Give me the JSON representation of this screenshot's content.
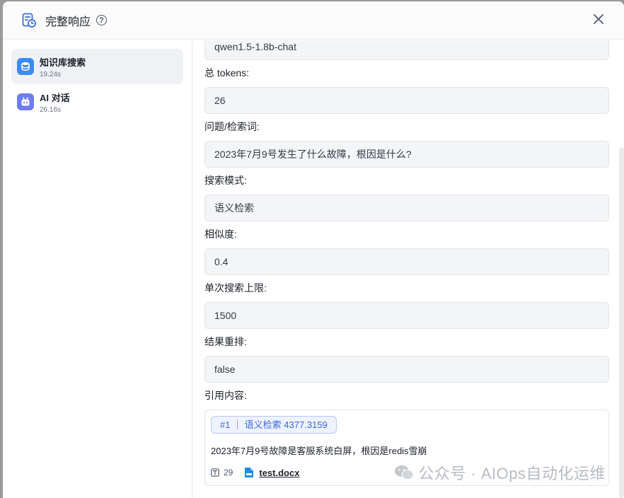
{
  "header": {
    "title": "完整响应",
    "help_symbol": "?"
  },
  "sidebar": {
    "items": [
      {
        "name": "知识库搜索",
        "time": "19.24s",
        "icon": "database-icon",
        "color": "#3b8cf5",
        "active": true
      },
      {
        "name": "AI 对话",
        "time": "26.16s",
        "icon": "robot-icon",
        "color": "#6f7cf6",
        "active": false
      }
    ]
  },
  "fields": {
    "model": {
      "value": "qwen1.5-1.8b-chat"
    },
    "tokens": {
      "label": "总 tokens:",
      "value": "26"
    },
    "question": {
      "label": "问题/检索词:",
      "value": "2023年7月9号发生了什么故障，根因是什么?"
    },
    "search_mode": {
      "label": "搜索模式:",
      "value": "语义检索"
    },
    "similarity": {
      "label": "相似度:",
      "value": "0.4"
    },
    "limit": {
      "label": "单次搜索上限:",
      "value": "1500"
    },
    "rerank": {
      "label": "结果重排:",
      "value": "false"
    },
    "quotes": {
      "label": "引用内容:",
      "tag": "#1 ｜ 语义检索 4377.3159",
      "text": "2023年7月9号故障是客服系统白屏，根因是redis雪崩",
      "count": "29",
      "file": "test.docx"
    }
  },
  "watermark": {
    "text": "公众号 · AIOps自动化运维"
  },
  "colors": {
    "accent": "#3d65d6",
    "field_bg": "#f4f5f7"
  }
}
